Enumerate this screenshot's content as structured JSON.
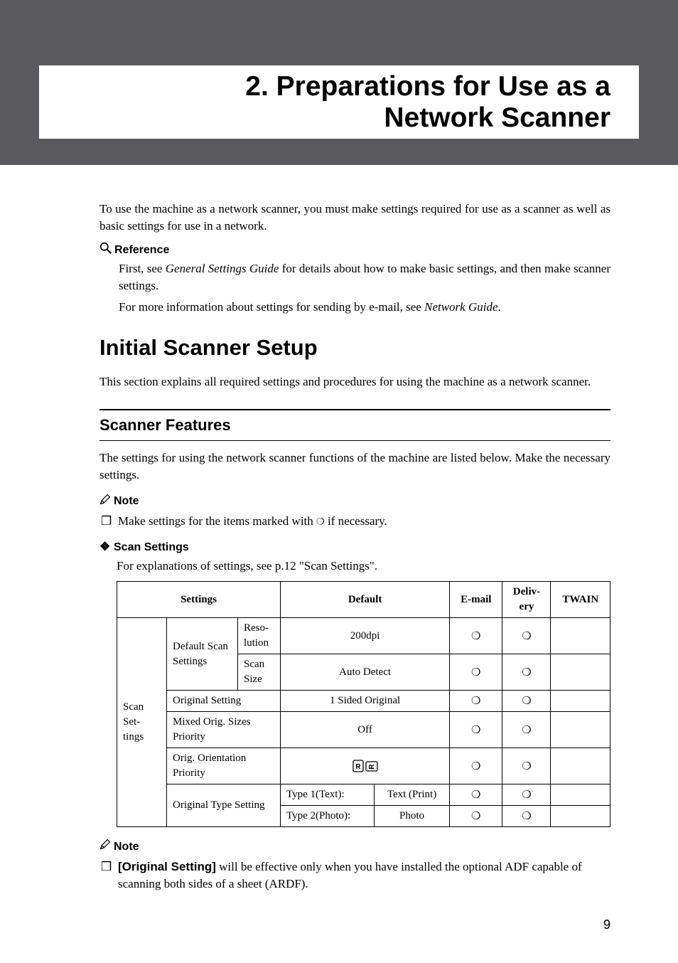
{
  "title_line1": "2. Preparations for Use as a",
  "title_line2": "Network Scanner",
  "intro": "To use the machine as a network scanner, you must make settings required for use as a scanner as well as basic settings for use in a network.",
  "reference_label": "Reference",
  "reference_p1a": "First, see ",
  "reference_p1_italic": "General Settings Guide",
  "reference_p1b": " for details about how to make basic settings, and then make scanner settings.",
  "reference_p2a": "For more information about settings for sending by e-mail, see ",
  "reference_p2_italic": "Network Guide",
  "reference_p2b": ".",
  "h2": "Initial Scanner Setup",
  "h2_body": "This section explains all required settings and procedures for using the machine as a network scanner.",
  "h3": "Scanner Features",
  "h3_body": "The settings for using the network scanner functions of the machine are listed below. Make the necessary settings.",
  "note_label": "Note",
  "note1_a": "Make settings for the items marked with ",
  "note1_b": " if necessary.",
  "circle": "❍",
  "scan_settings_label": "Scan Settings",
  "scan_settings_body": "For explanations of settings, see p.12 \"Scan Settings\".",
  "table": {
    "headers": {
      "settings": "Settings",
      "default": "Default",
      "email": "E-mail",
      "delivery": "Deliv-\nery",
      "twain": "TWAIN"
    },
    "col_scan_settings": "Scan Set-\ntings",
    "default_scan_settings": "Default Scan Settings",
    "resolution": "Reso-\nlution",
    "resolution_default": "200dpi",
    "scan_size": "Scan Size",
    "scan_size_default": "Auto Detect",
    "original_setting": "Original Setting",
    "original_setting_default": "1 Sided Original",
    "mixed_orig": "Mixed Orig. Sizes Priority",
    "mixed_orig_default": "Off",
    "orig_orientation": "Orig. Orientation Priority",
    "original_type": "Original Type Setting",
    "type1_label": "Type 1(Text):",
    "type1_val": "Text (Print)",
    "type2_label": "Type 2(Photo):",
    "type2_val": "Photo"
  },
  "note2_a": "[Original Setting]",
  "note2_b": " will be effective only when you have installed the optional ADF capable of scanning both sides of a sheet (ARDF).",
  "page_number": "9",
  "chart_data": {
    "type": "table",
    "title": "Scan Settings",
    "columns": [
      "Settings (L1)",
      "Settings (L2)",
      "Settings (L3)",
      "Default (col1)",
      "Default (col2)",
      "E-mail",
      "Delivery",
      "TWAIN"
    ],
    "rows": [
      [
        "Scan Settings",
        "Default Scan Settings",
        "Resolution",
        "200dpi",
        "",
        "❍",
        "❍",
        ""
      ],
      [
        "Scan Settings",
        "Default Scan Settings",
        "Scan Size",
        "Auto Detect",
        "",
        "❍",
        "❍",
        ""
      ],
      [
        "Scan Settings",
        "Original Setting",
        "",
        "1 Sided Original",
        "",
        "❍",
        "❍",
        ""
      ],
      [
        "Scan Settings",
        "Mixed Orig. Sizes Priority",
        "",
        "Off",
        "",
        "❍",
        "❍",
        ""
      ],
      [
        "Scan Settings",
        "Orig. Orientation Priority",
        "",
        "(orientation icons)",
        "",
        "❍",
        "❍",
        ""
      ],
      [
        "Scan Settings",
        "Original Type Setting",
        "",
        "Type 1(Text):",
        "Text (Print)",
        "❍",
        "❍",
        ""
      ],
      [
        "Scan Settings",
        "",
        "",
        "Type 2(Photo):",
        "Photo",
        "❍",
        "❍",
        ""
      ]
    ]
  }
}
